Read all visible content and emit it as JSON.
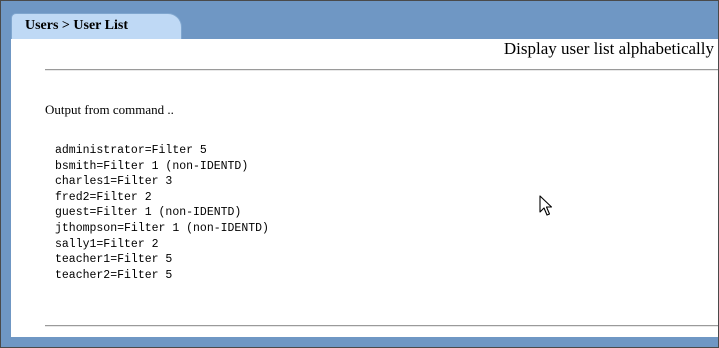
{
  "breadcrumb": {
    "label": "Users > User List"
  },
  "header": {
    "title": "Display user list alphabetically"
  },
  "output": {
    "label": "Output from command ..",
    "lines": [
      "administrator=Filter 5",
      "bsmith=Filter 1 (non-IDENTD)",
      "charles1=Filter 3",
      "fred2=Filter 2",
      "guest=Filter 1 (non-IDENTD)",
      "jthompson=Filter 1 (non-IDENTD)",
      "sally1=Filter 2",
      "teacher1=Filter 5",
      "teacher2=Filter 5"
    ]
  },
  "icons": {
    "cursor": "mouse-pointer-icon"
  },
  "colors": {
    "frame_background": "#6f97c4",
    "tab_background": "#bfd9f5",
    "panel_background": "#ffffff"
  }
}
